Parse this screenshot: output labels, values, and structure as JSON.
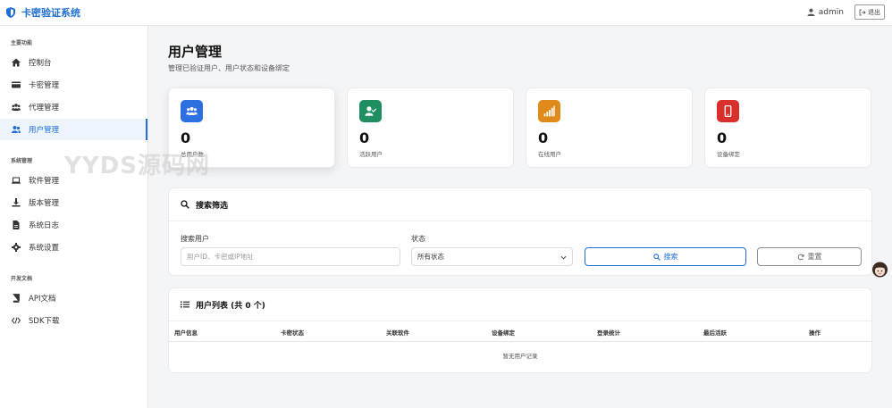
{
  "app": {
    "title": "卡密验证系统"
  },
  "header": {
    "username": "admin",
    "logout_label": "退出"
  },
  "sidebar": {
    "sections": [
      {
        "title": "主要功能",
        "items": [
          {
            "label": "控制台",
            "icon": "home-icon"
          },
          {
            "label": "卡密管理",
            "icon": "card-icon"
          },
          {
            "label": "代理管理",
            "icon": "users-icon"
          },
          {
            "label": "用户管理",
            "icon": "user-group-icon",
            "active": true
          }
        ]
      },
      {
        "title": "系统管理",
        "items": [
          {
            "label": "软件管理",
            "icon": "laptop-icon"
          },
          {
            "label": "版本管理",
            "icon": "download-icon"
          },
          {
            "label": "系统日志",
            "icon": "file-icon"
          },
          {
            "label": "系统设置",
            "icon": "gear-icon"
          }
        ]
      },
      {
        "title": "开发文档",
        "items": [
          {
            "label": "API文档",
            "icon": "book-icon"
          },
          {
            "label": "SDK下载",
            "icon": "code-icon"
          }
        ]
      }
    ]
  },
  "main": {
    "title": "用户管理",
    "subtitle": "管理已验证用户、用户状态和设备绑定"
  },
  "stats": [
    {
      "value": "0",
      "label": "总用户数",
      "color": "#2c6fe0",
      "icon": "users-icon"
    },
    {
      "value": "0",
      "label": "活跃用户",
      "color": "#1f8f62",
      "icon": "user-check-icon"
    },
    {
      "value": "0",
      "label": "在线用户",
      "color": "#e08a1c",
      "icon": "signal-icon"
    },
    {
      "value": "0",
      "label": "设备绑定",
      "color": "#d9302c",
      "icon": "mobile-icon"
    }
  ],
  "watermark": "YYDS源码网",
  "search": {
    "title": "搜索筛选",
    "user_label": "搜索用户",
    "user_placeholder": "用户ID、卡密或IP地址",
    "status_label": "状态",
    "status_value": "所有状态",
    "search_button": "搜索",
    "reset_button": "重置"
  },
  "table": {
    "title": "用户列表 (共 0 个)",
    "columns": [
      "用户信息",
      "卡密状态",
      "关联软件",
      "设备绑定",
      "登录统计",
      "最后活跃",
      "操作"
    ],
    "empty_text": "暂无用户记录"
  }
}
